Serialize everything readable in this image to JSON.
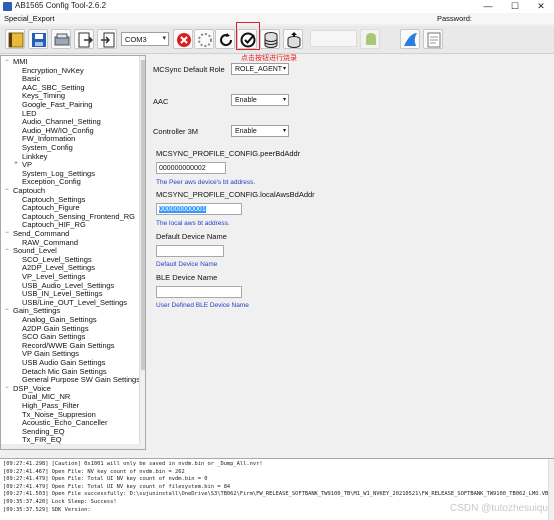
{
  "window": {
    "title": "AB1565 Config Tool-2.6.2",
    "controls": {
      "minimize": "—",
      "maximize": "☐",
      "close": "✕"
    }
  },
  "menubar": {
    "menu_label": "Special_Export",
    "password_label": "Password:",
    "password_value": ""
  },
  "toolbar": {
    "com_port": "COM3",
    "icons": [
      "open-folder-icon",
      "save-icon",
      "scanner-icon",
      "export-icon",
      "import-icon",
      "port-select",
      "disconnect-icon",
      "settings-loading-icon",
      "refresh-icon",
      "check-burn-icon",
      "database-icon",
      "database-upload-icon",
      "android-icon",
      "shark-fin-icon",
      "notepad-icon"
    ],
    "colors": {
      "highlight": "#e02020",
      "accent": "#2b5fb8"
    }
  },
  "annotation": "点击按钮进行烧录",
  "tree": {
    "nodes": [
      {
        "label": "MMI",
        "level": 0,
        "toggle": "−"
      },
      {
        "label": "Encryption_NvKey",
        "level": 1
      },
      {
        "label": "Basic",
        "level": 1
      },
      {
        "label": "AAC_SBC_Setting",
        "level": 1
      },
      {
        "label": "Keys_Timing",
        "level": 1
      },
      {
        "label": "Google_Fast_Pairing",
        "level": 1
      },
      {
        "label": "LED",
        "level": 1
      },
      {
        "label": "Audio_Channel_Setting",
        "level": 1
      },
      {
        "label": "Audio_HW/IO_Config",
        "level": 1
      },
      {
        "label": "FW_Information",
        "level": 1
      },
      {
        "label": "System_Config",
        "level": 1
      },
      {
        "label": "Linkkey",
        "level": 1
      },
      {
        "label": "VP",
        "level": 1,
        "toggle": "+"
      },
      {
        "label": "System_Log_Settings",
        "level": 1
      },
      {
        "label": "Exception_Config",
        "level": 1
      },
      {
        "label": "Captouch",
        "level": 0,
        "toggle": "−"
      },
      {
        "label": "Captouch_Settings",
        "level": 1
      },
      {
        "label": "Captouch_Figure",
        "level": 1
      },
      {
        "label": "Captouch_Sensing_Frontend_RG",
        "level": 1
      },
      {
        "label": "Captouch_HIF_RG",
        "level": 1
      },
      {
        "label": "Send_Command",
        "level": 0,
        "toggle": "−"
      },
      {
        "label": "RAW_Command",
        "level": 1
      },
      {
        "label": "Sound_Level",
        "level": 0,
        "toggle": "−"
      },
      {
        "label": "SCO_Level_Settings",
        "level": 1
      },
      {
        "label": "A2DP_Level_Settings",
        "level": 1
      },
      {
        "label": "VP_Level_Settings",
        "level": 1
      },
      {
        "label": "USB_Audio_Level_Settings",
        "level": 1
      },
      {
        "label": "USB_IN_Level_Settings",
        "level": 1
      },
      {
        "label": "USB/Line_OUT_Level_Settings",
        "level": 1
      },
      {
        "label": "Gain_Settings",
        "level": 0,
        "toggle": "−"
      },
      {
        "label": "Analog_Gain_Settings",
        "level": 1
      },
      {
        "label": "A2DP Gain Settings",
        "level": 1
      },
      {
        "label": "SCO Gain Settings",
        "level": 1
      },
      {
        "label": "Record/WWE Gain Settings",
        "level": 1
      },
      {
        "label": "VP Gain Settings",
        "level": 1
      },
      {
        "label": "USB Audio Gain Settings",
        "level": 1
      },
      {
        "label": "Detach Mic Gain Settings",
        "level": 1
      },
      {
        "label": "General Purpose SW Gain Settings",
        "level": 1
      },
      {
        "label": "DSP_Voice",
        "level": 0,
        "toggle": "−"
      },
      {
        "label": "Dual_MIC_NR",
        "level": 1
      },
      {
        "label": "High_Pass_Filter",
        "level": 1
      },
      {
        "label": "Tx_Noise_Suppresion",
        "level": 1
      },
      {
        "label": "Acoustic_Echo_Canceller",
        "level": 1
      },
      {
        "label": "Sending_EQ",
        "level": 1
      },
      {
        "label": "Tx_FIR_EQ",
        "level": 1
      }
    ]
  },
  "form": {
    "mcsync_role": {
      "label": "MCSync Default Role",
      "value": "ROLE_AGENT"
    },
    "aac": {
      "label": "AAC",
      "value": "Enable"
    },
    "controller_3m": {
      "label": "Controller 3M",
      "value": "Enable"
    },
    "peer_addr": {
      "label": "MCSYNC_PROFILE_CONFIG.peerBdAddr",
      "value": "000000000002",
      "hint": "The Peer aws device's bt address."
    },
    "local_addr": {
      "label": "MCSYNC_PROFILE_CONFIG.localAwsBdAddr",
      "value": "000000000001",
      "hint": "The local aws bt address."
    },
    "default_device_name": {
      "label": "Default Device Name",
      "value": "",
      "hint": "Default Device Name"
    },
    "ble_device_name": {
      "label": "BLE Device Name",
      "value": "",
      "hint": "User Defined BLE Device Name"
    }
  },
  "log": {
    "lines": [
      "[09:27:41.298] [Caution] 0x1001 will only be saved in nvdm.bin or _Dump_All.nvr!",
      "[09:27:41.467] Open File: NV key count of nvdm.bin = 262",
      "[09:27:41.479] Open File: Total UI NV key count of nvdm.bin = 0",
      "[09:27:41.479] Open File: Total UI NV key count of filesystem.bin = 84",
      "[09:27:41.503] Open File successfully: D:\\sujuninstall\\OneDrive\\S3\\TB062\\Firm\\FW_RELEASE_SOFTBANK_TW9100_TB\\M1_W1_NVKEY_20210521\\FW_RELEASE_SOFTBANK_TW9100_TB062_LMO.VB...",
      "[09:35:37.420] Lock Sleep: Success!",
      "[09:35:37.529] SDK Version:"
    ]
  },
  "watermark": "CSDN @tutozhesuiqu"
}
